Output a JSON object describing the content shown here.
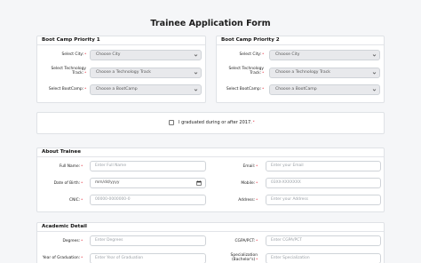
{
  "page": {
    "title": "Trainee Application Form"
  },
  "priority1": {
    "heading": "Boot Camp Priority 1",
    "city_label": "Select City:",
    "track_label_line1": "Select Technology",
    "track_label_line2": "Track:",
    "bootcamp_label": "Select BootCamp:",
    "city_value": "Choose City",
    "track_value": "Choose a Technology Track",
    "bootcamp_value": "Choose a BootCamp"
  },
  "priority2": {
    "heading": "Boot Camp Priority 2",
    "city_label": "Select City:",
    "track_label_line1": "Select Technology",
    "track_label_line2": "Track:",
    "bootcamp_label": "Select BootCamp:",
    "city_value": "Choose City",
    "track_value": "Choose a Technology Track",
    "bootcamp_value": "Choose a BootCamp"
  },
  "graduation": {
    "label": "I graduated during or after 2017."
  },
  "about": {
    "heading": "About Trainee",
    "full_name_label": "Full Name:",
    "full_name_placeholder": "Enter Full Name",
    "dob_label": "Date of Birth:",
    "dob_placeholder": "mm/dd/yyyy",
    "cnic_label": "CNIC:",
    "cnic_placeholder": "00000-0000000-0",
    "email_label": "Email:",
    "email_placeholder": "Enter your Email",
    "mobile_label": "Mobile:",
    "mobile_placeholder": "03XX-XXXXXXX",
    "address_label": "Address:",
    "address_placeholder": "Enter your Address"
  },
  "academic": {
    "heading": "Academic Detail",
    "degrees_label": "Degrees:",
    "degrees_placeholder": "Enter Degrees",
    "cgpa_label": "CGPA/PCT:",
    "cgpa_placeholder": "Enter CGPA/PCT",
    "year_label": "Year of Graduation:",
    "year_placeholder": "Enter Year of Graduation",
    "spec_label_line1": "Specialization",
    "spec_label_line2": "(Bachelor's)",
    "spec_placeholder": "Enter Specialization"
  }
}
